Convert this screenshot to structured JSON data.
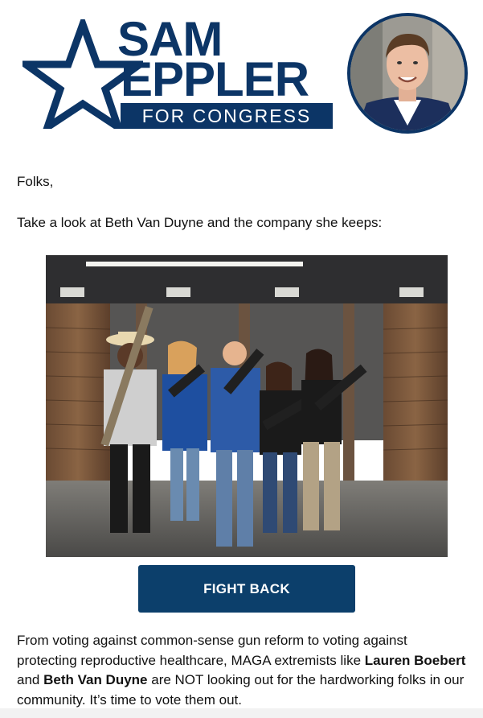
{
  "brand": {
    "name_line1": "SAM",
    "name_line2": "EPPLER",
    "tagline": "FOR CONGRESS",
    "color": "#0c3566"
  },
  "icons": {
    "logo_star": "star-outline-icon",
    "avatar": "candidate-portrait"
  },
  "content": {
    "greeting": "Folks,",
    "intro": "Take a look at Beth Van Duyne and the company she keeps:",
    "cta_label": "FIGHT BACK",
    "cta_color": "#0c3f6b",
    "para_1": "From voting against common-sense gun reform to voting against protecting reproductive healthcare, MAGA extremists like ",
    "para_bold_1": "Lauren Boebert",
    "para_2": " and ",
    "para_bold_2": "Beth Van Duyne",
    "para_3": " are NOT looking out for the hardworking folks in our community. It’s time to vote them out."
  }
}
